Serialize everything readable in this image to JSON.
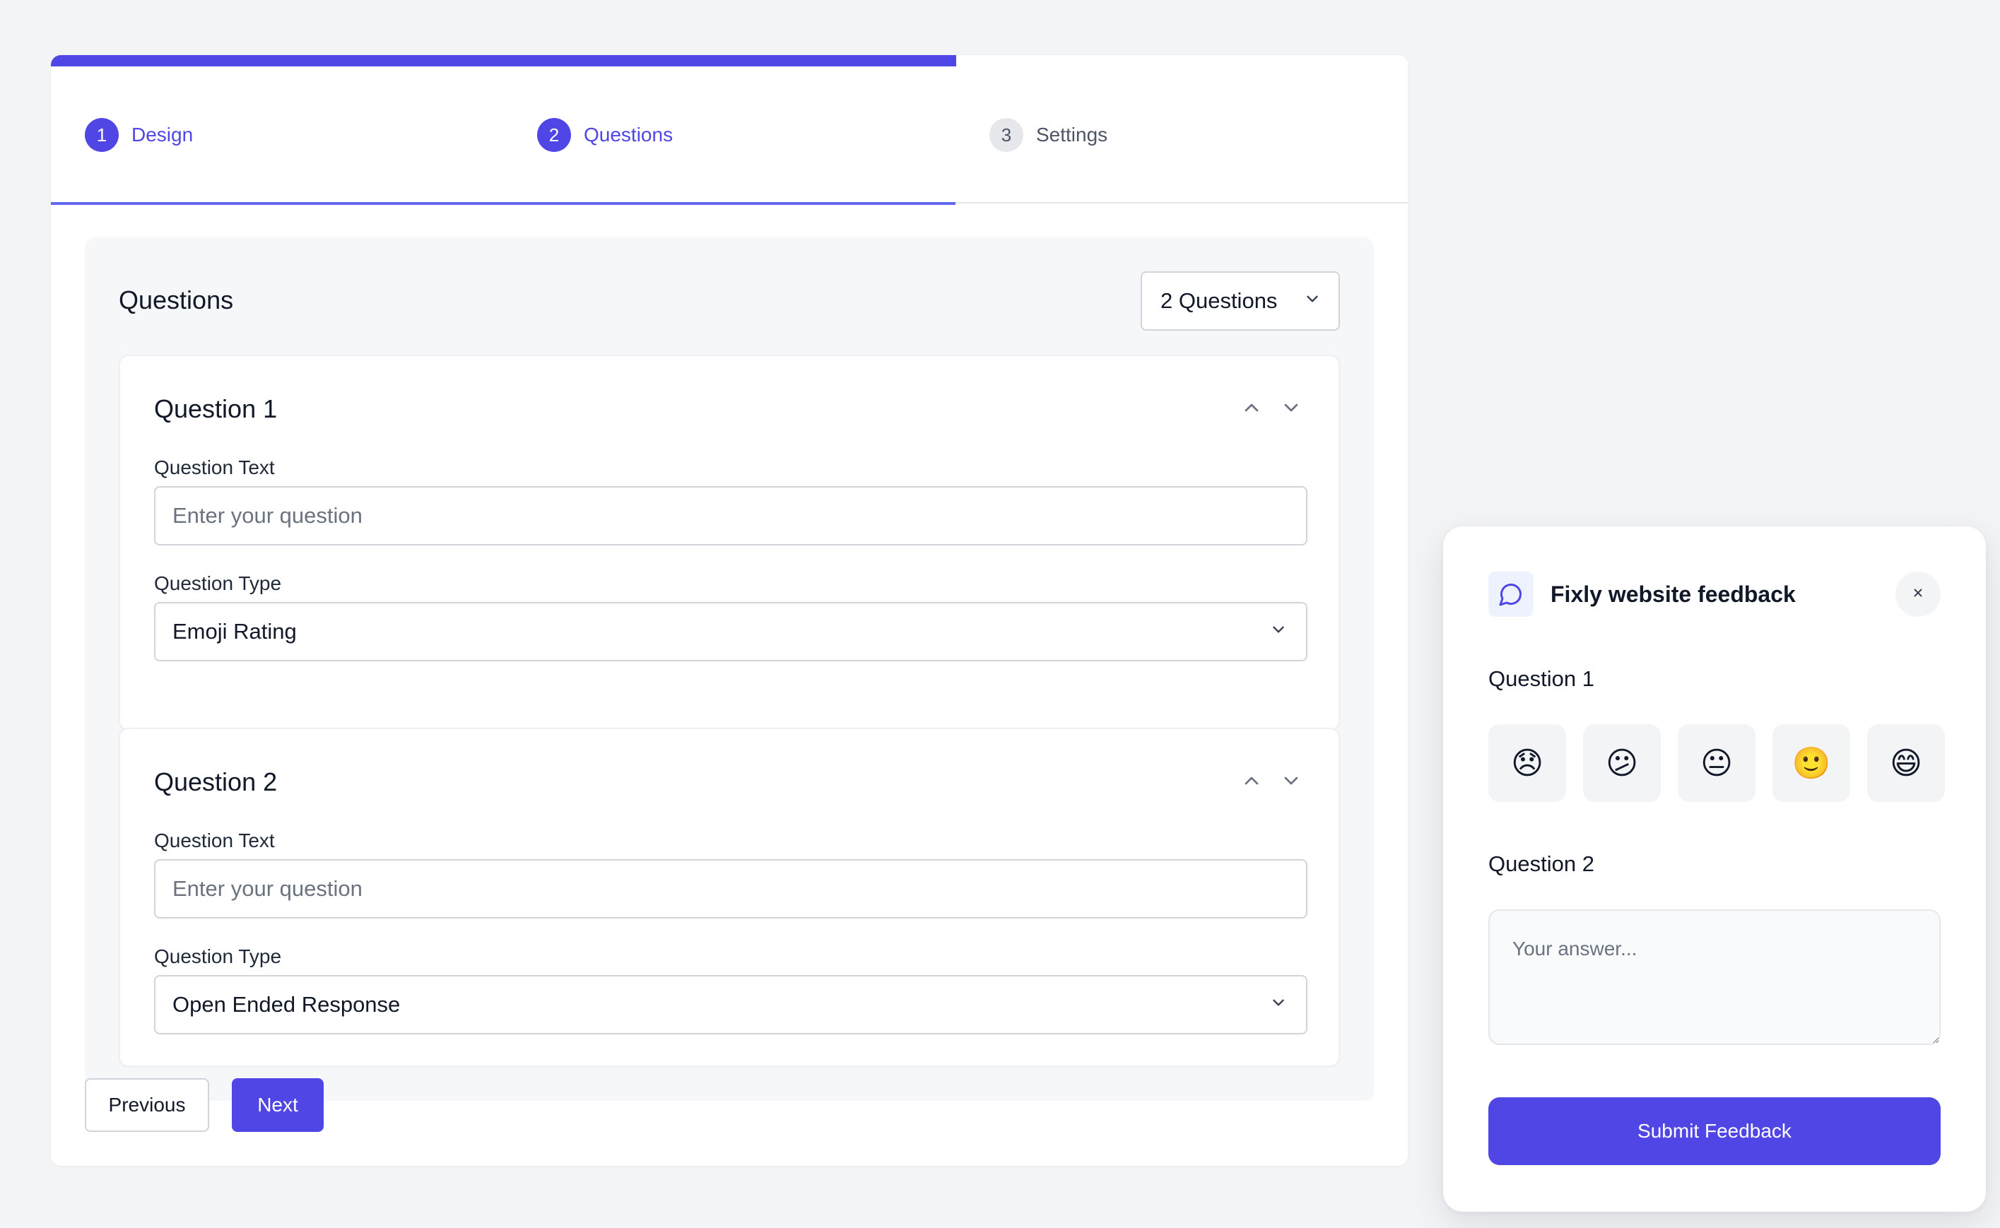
{
  "wizard": {
    "progress": 0.667,
    "steps": [
      {
        "number": "1",
        "label": "Design",
        "state": "done"
      },
      {
        "number": "2",
        "label": "Questions",
        "state": "active"
      },
      {
        "number": "3",
        "label": "Settings",
        "state": "pending"
      }
    ]
  },
  "questions_panel": {
    "title": "Questions",
    "count_selected": "2 Questions",
    "cards": [
      {
        "title": "Question 1",
        "text_label": "Question Text",
        "text_placeholder": "Enter your question",
        "text_value": "",
        "type_label": "Question Type",
        "type_value": "Emoji Rating"
      },
      {
        "title": "Question 2",
        "text_label": "Question Text",
        "text_placeholder": "Enter your question",
        "text_value": "",
        "type_label": "Question Type",
        "type_value": "Open Ended Response"
      }
    ]
  },
  "nav": {
    "previous_label": "Previous",
    "next_label": "Next"
  },
  "widget": {
    "icon": "chat-bubble-icon",
    "title": "Fixly website feedback",
    "close_icon": "×",
    "question1": "Question 1",
    "emojis": [
      "😞",
      "😕",
      "😐",
      "🙂",
      "😄"
    ],
    "question2": "Question 2",
    "answer_placeholder": "Your answer...",
    "submit_label": "Submit Feedback"
  },
  "colors": {
    "accent": "#4f46e5",
    "background": "#f3f4f6",
    "panel": "#f6f7f9"
  }
}
